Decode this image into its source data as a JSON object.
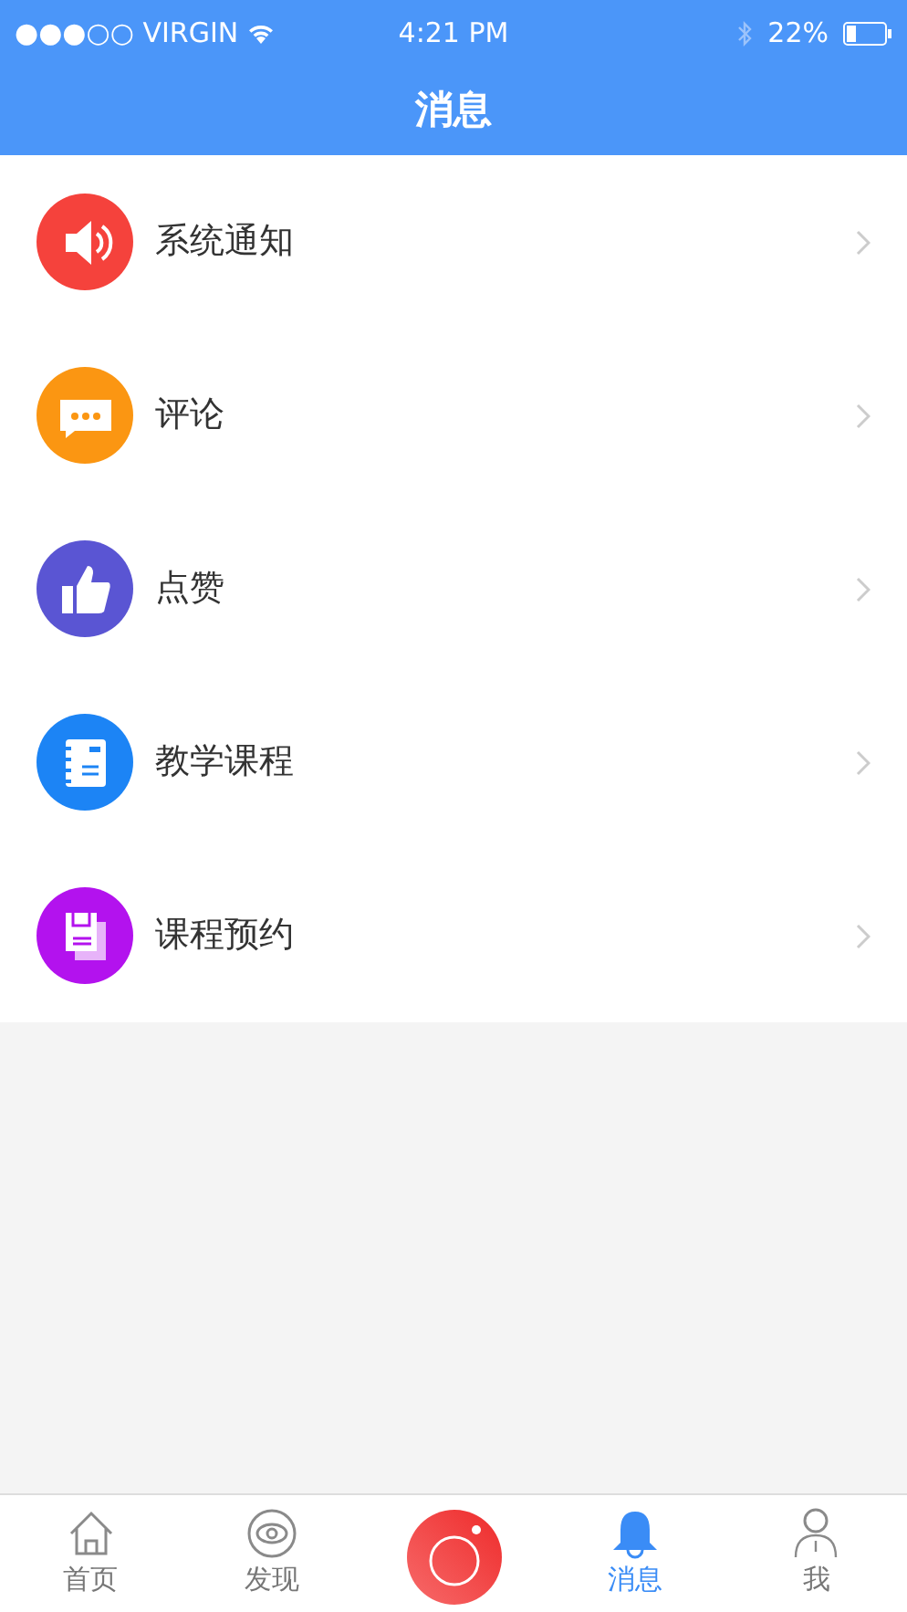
{
  "status_bar": {
    "carrier": "●●●○○ VIRGIN",
    "time": "4:21 PM",
    "battery": "22%"
  },
  "header": {
    "title": "消息"
  },
  "items": [
    {
      "label": "系统通知",
      "kind": "speaker",
      "color": "#f5423c"
    },
    {
      "label": "评论",
      "kind": "chat",
      "color": "#fb9612"
    },
    {
      "label": "点赞",
      "kind": "thumb",
      "color": "#5a55d3"
    },
    {
      "label": "教学课程",
      "kind": "notebook",
      "color": "#1c84f5"
    },
    {
      "label": "课程预约",
      "kind": "document",
      "color": "#b312ee"
    }
  ],
  "tab_bar": [
    {
      "kind": "home",
      "label": "首页",
      "selected": false
    },
    {
      "kind": "eye",
      "label": "发现",
      "selected": false
    },
    {
      "kind": "camera",
      "selected": false
    },
    {
      "kind": "bell",
      "label": "消息",
      "selected": true
    },
    {
      "kind": "person",
      "label": "我",
      "selected": false
    }
  ]
}
